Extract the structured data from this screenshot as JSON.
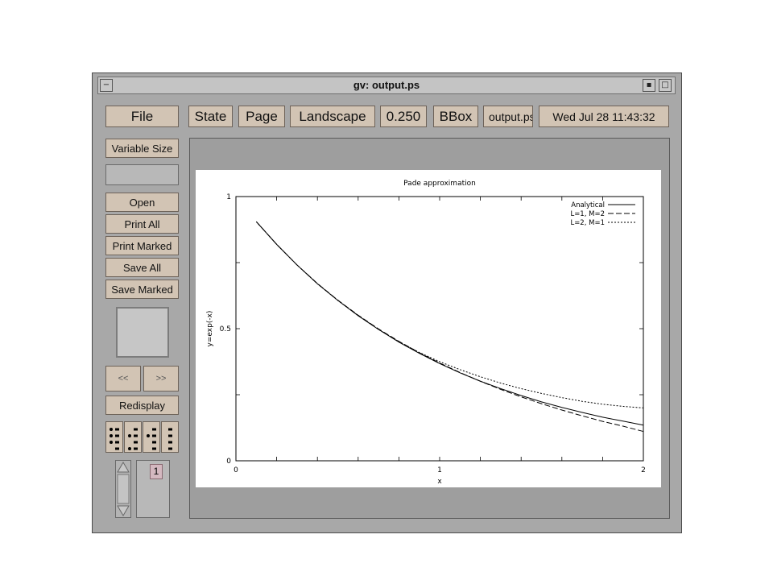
{
  "window": {
    "title": "gv: output.ps"
  },
  "toolbar": {
    "file": "File",
    "state": "State",
    "page": "Page",
    "orientation": "Landscape",
    "scale": "0.250",
    "bbox": "BBox",
    "filename": "output.ps",
    "date": "Wed Jul 28 11:43:32"
  },
  "sidebar": {
    "variable_size": "Variable Size",
    "open": "Open",
    "print_all": "Print All",
    "print_marked": "Print Marked",
    "save_all": "Save All",
    "save_marked": "Save Marked",
    "prev": "<<",
    "next": ">>",
    "redisplay": "Redisplay",
    "page_number": "1"
  },
  "chart_data": {
    "type": "line",
    "title": "Pade approximation",
    "xlabel": "x",
    "ylabel": "y=exp(-x)",
    "xlim": [
      0,
      2
    ],
    "ylim": [
      0,
      1
    ],
    "x_ticks": [
      "0",
      "1",
      "2"
    ],
    "y_ticks": [
      "0",
      "0.5",
      "1"
    ],
    "legend_position": "top-right",
    "series": [
      {
        "name": "Analytical",
        "style": "solid",
        "x": [
          0.1,
          0.2,
          0.3,
          0.4,
          0.5,
          0.6,
          0.7,
          0.8,
          0.9,
          1.0,
          1.1,
          1.2,
          1.3,
          1.4,
          1.5,
          1.6,
          1.7,
          1.8,
          1.9,
          2.0
        ],
        "values": [
          0.905,
          0.819,
          0.741,
          0.67,
          0.607,
          0.549,
          0.497,
          0.449,
          0.407,
          0.368,
          0.333,
          0.301,
          0.273,
          0.247,
          0.223,
          0.202,
          0.183,
          0.165,
          0.15,
          0.135
        ]
      },
      {
        "name": "L=1, M=2",
        "style": "dashed",
        "x": [
          0.1,
          0.2,
          0.3,
          0.4,
          0.5,
          0.6,
          0.7,
          0.8,
          0.9,
          1.0,
          1.1,
          1.2,
          1.3,
          1.4,
          1.5,
          1.6,
          1.7,
          1.8,
          1.9,
          2.0
        ],
        "values": [
          0.905,
          0.819,
          0.741,
          0.671,
          0.608,
          0.551,
          0.499,
          0.452,
          0.409,
          0.37,
          0.334,
          0.301,
          0.27,
          0.242,
          0.216,
          0.192,
          0.17,
          0.149,
          0.131,
          0.111
        ]
      },
      {
        "name": "L=2, M=1",
        "style": "dotted",
        "x": [
          0.1,
          0.2,
          0.3,
          0.4,
          0.5,
          0.6,
          0.7,
          0.8,
          0.9,
          1.0,
          1.1,
          1.2,
          1.3,
          1.4,
          1.5,
          1.6,
          1.7,
          1.8,
          1.9,
          2.0
        ],
        "values": [
          0.905,
          0.819,
          0.741,
          0.67,
          0.607,
          0.55,
          0.497,
          0.451,
          0.41,
          0.375,
          0.345,
          0.318,
          0.294,
          0.273,
          0.255,
          0.239,
          0.225,
          0.214,
          0.206,
          0.2
        ]
      }
    ]
  }
}
